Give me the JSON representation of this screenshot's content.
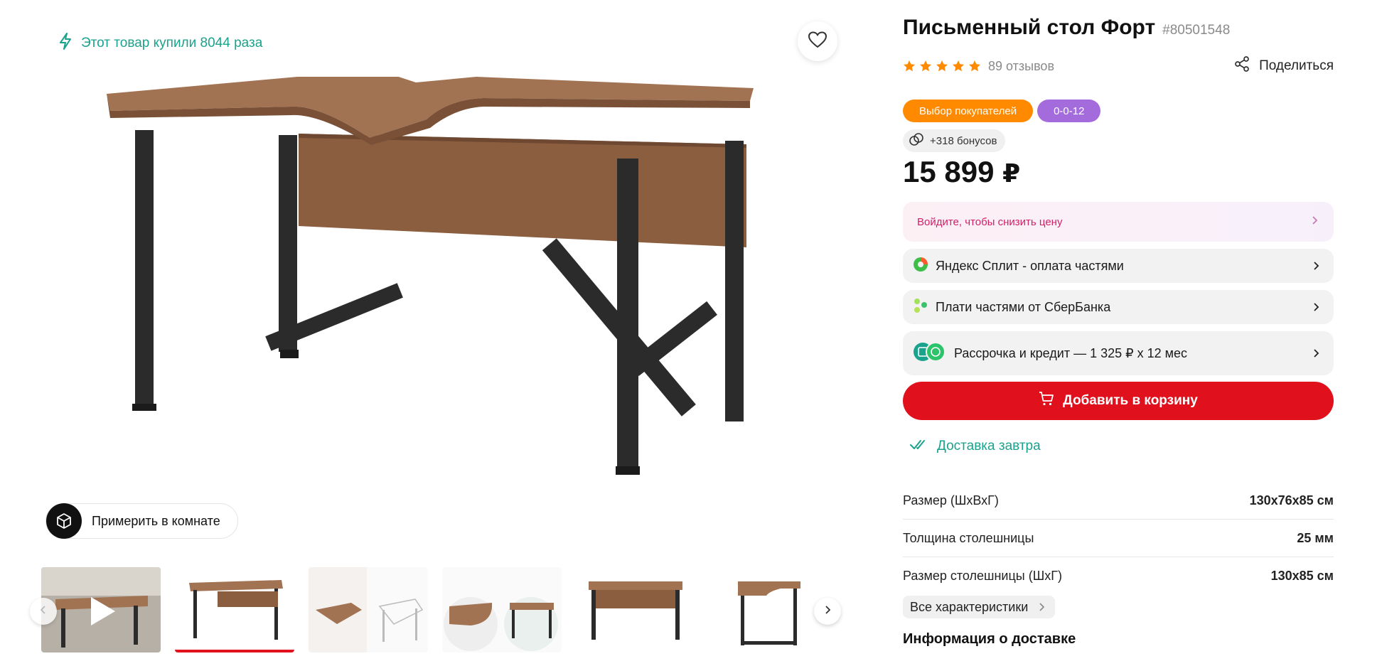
{
  "gallery": {
    "bought_text": "Этот товар купили 8044 раза",
    "try_in_room": "Примерить в комнате",
    "thumbnails": [
      {
        "kind": "video"
      },
      {
        "kind": "photo",
        "active": true
      },
      {
        "kind": "photo"
      },
      {
        "kind": "photo"
      },
      {
        "kind": "photo"
      },
      {
        "kind": "photo"
      }
    ],
    "icons": {
      "bought": "lightning-icon",
      "favorite": "heart-icon",
      "try_room": "ar-cube-icon",
      "prev": "chevron-left-icon",
      "next": "chevron-right-icon"
    }
  },
  "product": {
    "title": "Письменный стол Форт",
    "sku": "#80501548",
    "rating": 5,
    "reviews": "89 отзывов",
    "share_label": "Поделиться",
    "badges": [
      {
        "label": "Выбор покупателей",
        "color": "#ff8a00"
      },
      {
        "label": "0-0-12",
        "color": "#a46bdc"
      }
    ],
    "bonus": "+318 бонусов",
    "price": "15 899",
    "currency": "₽"
  },
  "offers": {
    "login_price": "Войдите, чтобы снизить цену",
    "split": "Яндекс Сплит - оплата частями",
    "sber": "Плати частями от СберБанка",
    "credit": "Рассрочка и кредит — 1 325 ₽ x 12 мес"
  },
  "cart": {
    "add_label": "Добавить в корзину"
  },
  "delivery": {
    "label": "Доставка завтра"
  },
  "specs": [
    {
      "name": "Размер (ШхВхГ)",
      "value": "130х76х85 см"
    },
    {
      "name": "Толщина столешницы",
      "value": "25 мм"
    },
    {
      "name": "Размер столешницы (ШхГ)",
      "value": "130х85 см"
    }
  ],
  "all_specs_label": "Все характеристики",
  "delivery_info_title": "Информация о доставке",
  "colors": {
    "accent_red": "#e0101c",
    "accent_green": "#1aa38c",
    "star_orange": "#ff8a00",
    "wood": "#9a6a4a",
    "metal": "#2b2b2b"
  }
}
